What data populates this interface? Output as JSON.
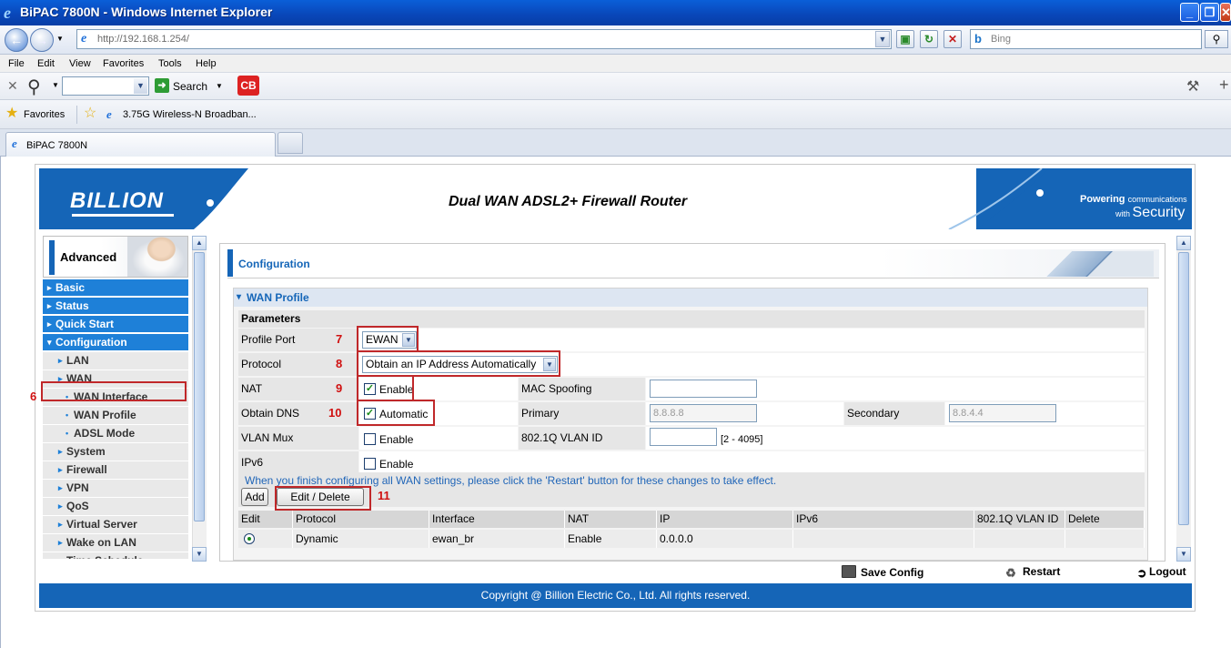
{
  "window": {
    "title": "BiPAC 7800N - Windows Internet Explorer"
  },
  "address": {
    "url": "http://192.168.1.254/",
    "search_placeholder": "Bing"
  },
  "menu": [
    "File",
    "Edit",
    "View",
    "Favorites",
    "Tools",
    "Help"
  ],
  "toolbar": {
    "search_label": "Search",
    "cb_label": "CB"
  },
  "favorites": {
    "label": "Favorites",
    "link": "3.75G Wireless-N Broadban..."
  },
  "tab": {
    "title": "BiPAC 7800N"
  },
  "router": {
    "brand": "BILLION",
    "title": "Dual WAN ADSL2+ Firewall Router",
    "tagline_a": "Powering",
    "tagline_b": "communications",
    "tagline_c": "with",
    "tagline_d": "Security"
  },
  "sidebar": {
    "section": "Advanced",
    "items": [
      {
        "label": "Basic"
      },
      {
        "label": "Status"
      },
      {
        "label": "Quick Start"
      },
      {
        "label": "Configuration"
      },
      {
        "label": "LAN"
      },
      {
        "label": "WAN"
      },
      {
        "label": "WAN Interface"
      },
      {
        "label": "WAN Profile"
      },
      {
        "label": "ADSL Mode"
      },
      {
        "label": "System"
      },
      {
        "label": "Firewall"
      },
      {
        "label": "VPN"
      },
      {
        "label": "QoS"
      },
      {
        "label": "Virtual Server"
      },
      {
        "label": "Wake on LAN"
      },
      {
        "label": "Time Schedule"
      }
    ]
  },
  "annotations": {
    "a6": "6",
    "a7": "7",
    "a8": "8",
    "a9": "9",
    "a10": "10",
    "a11": "11"
  },
  "main": {
    "header": "Configuration",
    "section": "WAN Profile",
    "params_title": "Parameters",
    "profile_port": {
      "label": "Profile Port",
      "value": "EWAN"
    },
    "protocol": {
      "label": "Protocol",
      "value": "Obtain an IP Address Automatically"
    },
    "nat": {
      "label": "NAT",
      "check_label": "Enable",
      "checked": true
    },
    "mac_spoofing": {
      "label": "MAC Spoofing",
      "value": ""
    },
    "obtain_dns": {
      "label": "Obtain DNS",
      "check_label": "Automatic",
      "checked": true
    },
    "primary": {
      "label": "Primary",
      "placeholder": "8.8.8.8"
    },
    "secondary": {
      "label": "Secondary",
      "placeholder": "8.8.4.4"
    },
    "vlan_mux": {
      "label": "VLAN Mux",
      "check_label": "Enable",
      "checked": false
    },
    "vlan_id": {
      "label": "802.1Q VLAN ID",
      "value": "",
      "range": "[2 - 4095]"
    },
    "ipv6": {
      "label": "IPv6",
      "check_label": "Enable",
      "checked": false
    },
    "note": "When you finish configuring all WAN settings, please click the 'Restart' button for these changes to take effect.",
    "add_label": "Add",
    "edit_label": "Edit / Delete",
    "table": {
      "headers": [
        "Edit",
        "Protocol",
        "Interface",
        "NAT",
        "IP",
        "IPv6",
        "802.1Q VLAN ID",
        "Delete"
      ],
      "rows": [
        {
          "protocol": "Dynamic",
          "interface": "ewan_br",
          "nat": "Enable",
          "ip": "0.0.0.0",
          "ipv6": "",
          "vlan": "",
          "delete": ""
        }
      ]
    }
  },
  "actions": {
    "save": "Save Config",
    "restart": "Restart",
    "logout": "Logout"
  },
  "footer": "Copyright @ Billion Electric Co., Ltd. All rights reserved."
}
